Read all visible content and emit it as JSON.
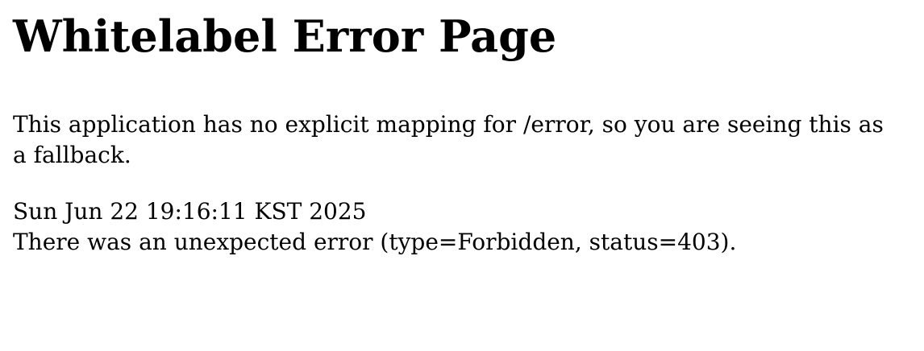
{
  "page": {
    "title": "Whitelabel Error Page",
    "message": "This application has no explicit mapping for /error, so you are seeing this as a fallback.",
    "timestamp": "Sun Jun 22 19:16:11 KST 2025",
    "error_detail": "There was an unexpected error (type=Forbidden, status=403)."
  }
}
